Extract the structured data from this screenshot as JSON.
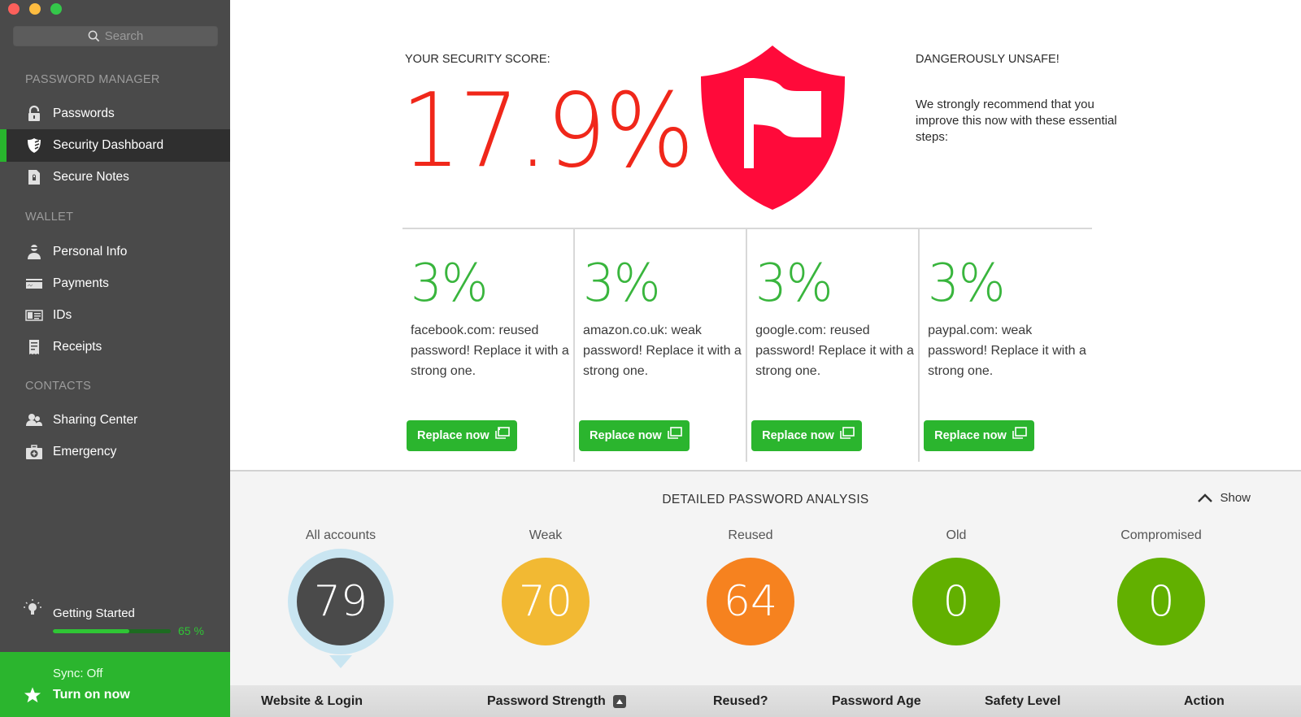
{
  "window": {
    "controls": [
      "close",
      "minimize",
      "zoom"
    ]
  },
  "sidebar": {
    "search_placeholder": "Search",
    "sections": [
      {
        "label": "PASSWORD MANAGER",
        "items": [
          {
            "label": "Passwords",
            "icon": "lock-icon",
            "active": false
          },
          {
            "label": "Security Dashboard",
            "icon": "shield-icon",
            "active": true
          },
          {
            "label": "Secure Notes",
            "icon": "note-icon",
            "active": false
          }
        ]
      },
      {
        "label": "WALLET",
        "items": [
          {
            "label": "Personal Info",
            "icon": "person-icon",
            "active": false
          },
          {
            "label": "Payments",
            "icon": "credit-card-icon",
            "active": false
          },
          {
            "label": "IDs",
            "icon": "id-card-icon",
            "active": false
          },
          {
            "label": "Receipts",
            "icon": "receipt-icon",
            "active": false
          }
        ]
      },
      {
        "label": "CONTACTS",
        "items": [
          {
            "label": "Sharing Center",
            "icon": "people-icon",
            "active": false
          },
          {
            "label": "Emergency",
            "icon": "first-aid-icon",
            "active": false
          }
        ]
      }
    ],
    "getting_started": {
      "label": "Getting Started",
      "progress": 65,
      "progress_label": "65 %"
    },
    "sync": {
      "status": "Sync: Off",
      "action": "Turn on now"
    }
  },
  "score": {
    "label": "YOUR SECURITY SCORE:",
    "value": "17.9%",
    "verdict": "DANGEROUSLY UNSAFE!",
    "recommendation": "We strongly recommend that you improve this now with these essential steps:",
    "color": "#f0271a",
    "shield_color": "#ff0a3a"
  },
  "tips": [
    {
      "percent": "3%",
      "text": "facebook.com: reused password! Replace it with a strong one.",
      "button": "Replace now"
    },
    {
      "percent": "3%",
      "text": "amazon.co.uk: weak password! Replace it with a strong one.",
      "button": "Replace now"
    },
    {
      "percent": "3%",
      "text": "google.com: reused password! Replace it with a strong one.",
      "button": "Replace now"
    },
    {
      "percent": "3%",
      "text": "paypal.com: weak password! Replace it with a strong one.",
      "button": "Replace now"
    }
  ],
  "analysis": {
    "title": "DETAILED PASSWORD ANALYSIS",
    "toggle_label": "Show",
    "stats": [
      {
        "label": "All accounts",
        "value": "79",
        "color": "#4a4a4a",
        "selected": true
      },
      {
        "label": "Weak",
        "value": "70",
        "color": "#f2b933",
        "selected": false
      },
      {
        "label": "Reused",
        "value": "64",
        "color": "#f6821f",
        "selected": false
      },
      {
        "label": "Old",
        "value": "0",
        "color": "#62b000",
        "selected": false
      },
      {
        "label": "Compromised",
        "value": "0",
        "color": "#62b000",
        "selected": false
      }
    ]
  },
  "table": {
    "columns": [
      "Website & Login",
      "Password Strength",
      "Reused?",
      "Password Age",
      "Safety Level",
      "Action"
    ],
    "sorted_column": "Password Strength",
    "sort_direction": "ascending"
  }
}
